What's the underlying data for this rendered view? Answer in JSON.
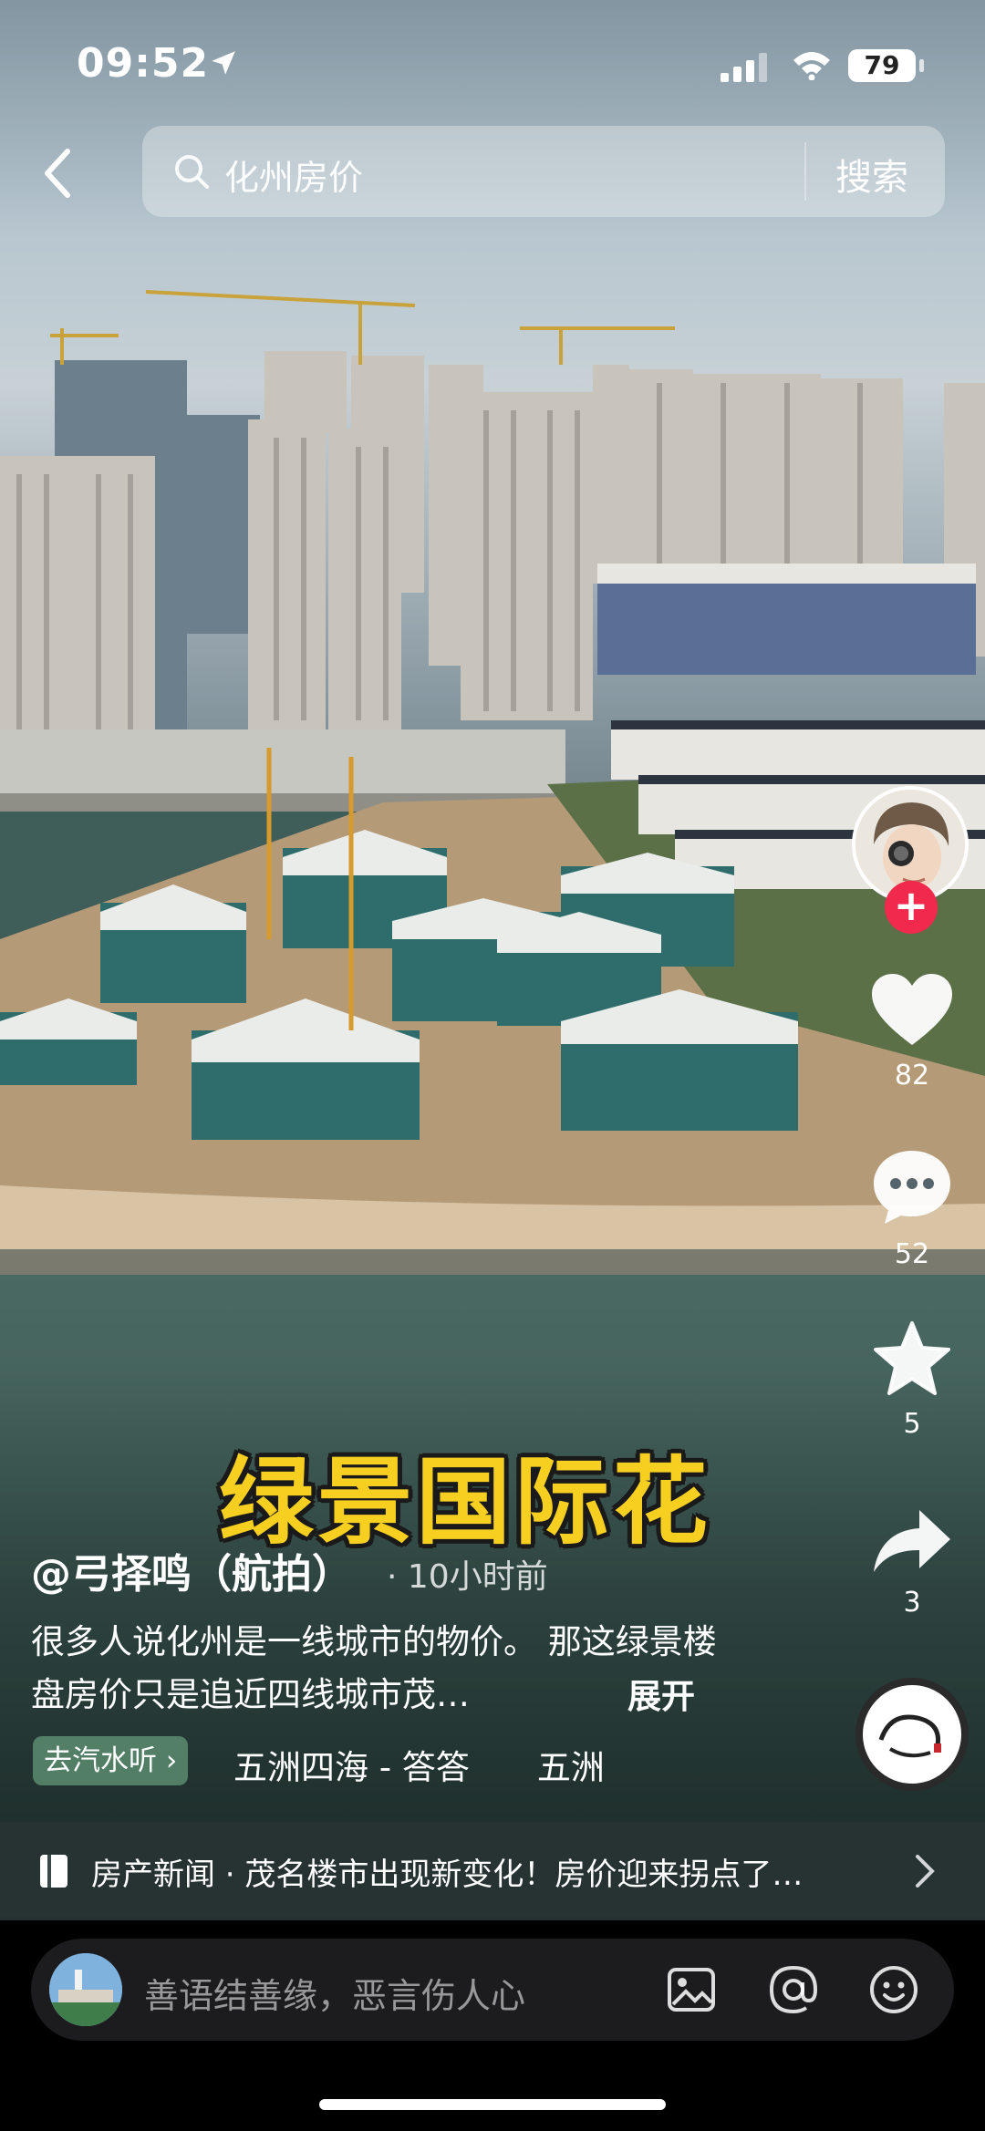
{
  "status_bar": {
    "time": "09:52",
    "battery": "79"
  },
  "search": {
    "query": "化州房价",
    "button": "搜索"
  },
  "video": {
    "overlay_caption": "绿景国际花"
  },
  "actions": {
    "likes": "82",
    "comments": "52",
    "favorites": "5",
    "shares": "3"
  },
  "post": {
    "author": "@弓择鸣（航拍）",
    "time": "· 10小时前",
    "description": "很多人说化州是一线城市的物价。 那这绿景楼盘房价只是追近四线城市茂…",
    "expand": "展开",
    "music_tag": "去汽水听 ›",
    "music_title": "五洲四海 - 答答　　五洲四海 - 答答"
  },
  "news": {
    "text": "房产新闻 · 茂名楼市出现新变化！房价迎来拐点了…"
  },
  "comment_input": {
    "placeholder": "善语结善缘，恶言伤人心"
  },
  "colors": {
    "caption_yellow": "#f6cf21",
    "follow_red": "#f0294d",
    "music_tag_green": "#5a8c6e"
  }
}
